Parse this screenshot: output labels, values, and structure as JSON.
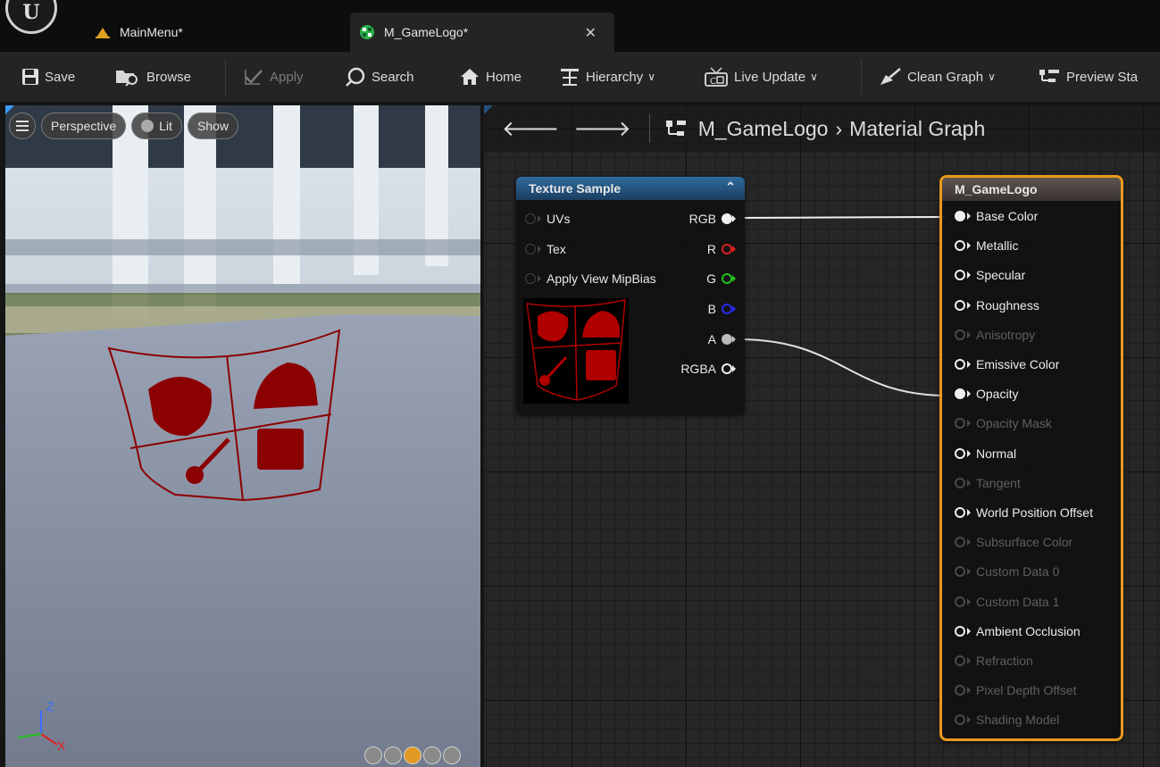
{
  "tabs": [
    {
      "label": "MainMenu*",
      "icon": "level-icon"
    },
    {
      "label": "M_GameLogo*",
      "icon": "material-icon",
      "active": true
    }
  ],
  "tab_close": "✕",
  "toolbar": {
    "save": "Save",
    "browse": "Browse",
    "apply": "Apply",
    "search": "Search",
    "home": "Home",
    "hierarchy": "Hierarchy",
    "live_update": "Live Update",
    "clean_graph": "Clean Graph",
    "preview_stats": "Preview Sta"
  },
  "viewport": {
    "perspective": "Perspective",
    "lit": "Lit",
    "show": "Show",
    "axis_z": "Z",
    "axis_x": "X"
  },
  "graph": {
    "breadcrumb_asset": "M_GameLogo",
    "breadcrumb_graph": "Material Graph",
    "texture_node": {
      "title": "Texture Sample",
      "inputs": [
        "UVs",
        "Tex",
        "Apply View MipBias"
      ],
      "outputs": [
        {
          "label": "RGB",
          "color": "#f0f0f0",
          "filled": true
        },
        {
          "label": "R",
          "color": "#e02020",
          "filled": false
        },
        {
          "label": "G",
          "color": "#22c422",
          "filled": false
        },
        {
          "label": "B",
          "color": "#2a2ae8",
          "filled": false
        },
        {
          "label": "A",
          "color": "#bbbbbb",
          "filled": true
        },
        {
          "label": "RGBA",
          "color": "#f0f0f0",
          "filled": false
        }
      ]
    },
    "material_node": {
      "title": "M_GameLogo",
      "pins": [
        {
          "label": "Base Color",
          "state": "connected"
        },
        {
          "label": "Metallic",
          "state": "enabled"
        },
        {
          "label": "Specular",
          "state": "enabled"
        },
        {
          "label": "Roughness",
          "state": "enabled"
        },
        {
          "label": "Anisotropy",
          "state": "disabled"
        },
        {
          "label": "Emissive Color",
          "state": "enabled"
        },
        {
          "label": "Opacity",
          "state": "connected"
        },
        {
          "label": "Opacity Mask",
          "state": "disabled"
        },
        {
          "label": "Normal",
          "state": "enabled"
        },
        {
          "label": "Tangent",
          "state": "disabled"
        },
        {
          "label": "World Position Offset",
          "state": "enabled"
        },
        {
          "label": "Subsurface Color",
          "state": "disabled"
        },
        {
          "label": "Custom Data 0",
          "state": "disabled"
        },
        {
          "label": "Custom Data 1",
          "state": "disabled"
        },
        {
          "label": "Ambient Occlusion",
          "state": "enabled"
        },
        {
          "label": "Refraction",
          "state": "disabled"
        },
        {
          "label": "Pixel Depth Offset",
          "state": "disabled"
        },
        {
          "label": "Shading Model",
          "state": "disabled"
        }
      ]
    }
  },
  "colors": {
    "accent": "#e89a1c",
    "logo_red": "#8b0000",
    "node_header_blue": "#2f6a9e"
  }
}
